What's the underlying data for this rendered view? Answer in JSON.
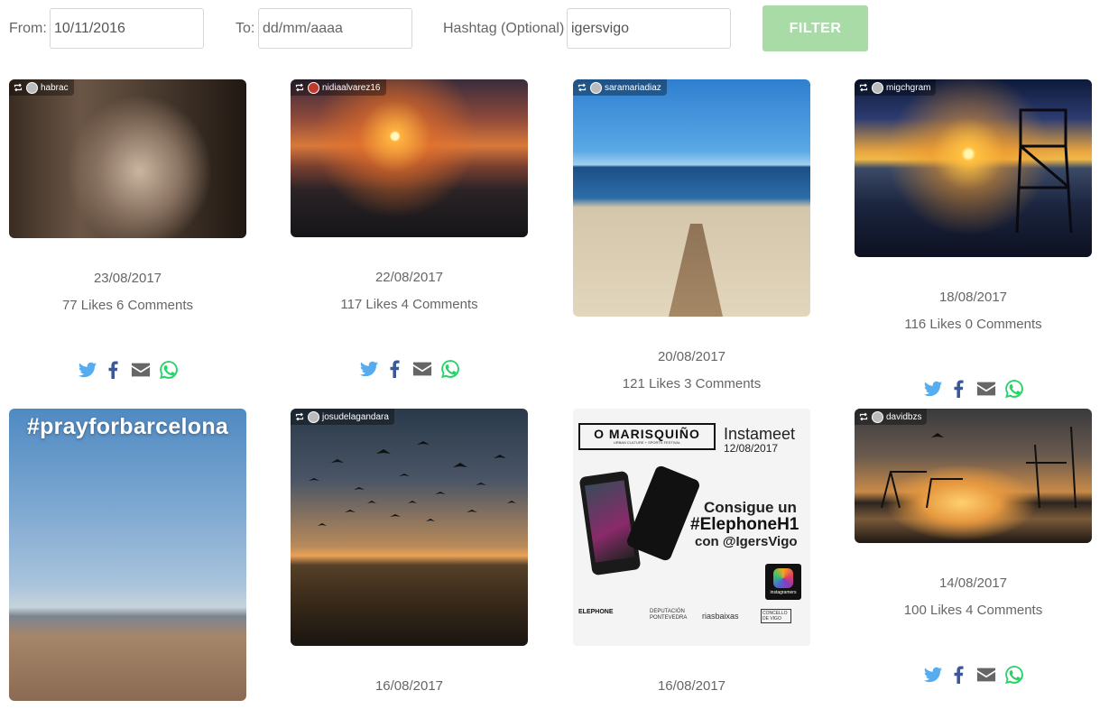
{
  "filters": {
    "from_label": "From:",
    "from_value": "10/11/2016",
    "to_label": "To:",
    "to_placeholder": "dd/mm/aaaa",
    "hashtag_label": "Hashtag (Optional)",
    "hashtag_value": "igersvigo",
    "filter_button": "FILTER"
  },
  "colors": {
    "twitter": "#55acee",
    "facebook": "#3b5998",
    "email": "#666666",
    "whatsapp": "#25d366",
    "filter_button": "#a9dba7"
  },
  "posts": [
    {
      "user": "habrac",
      "date": "23/08/2017",
      "stats": "77 Likes 6 Comments"
    },
    {
      "user": "nidiaalvarez16",
      "date": "22/08/2017",
      "stats": "117 Likes 4 Comments"
    },
    {
      "user": "saramariadiaz",
      "date": "20/08/2017",
      "stats": "121 Likes 3 Comments"
    },
    {
      "user": "migchgram",
      "date": "18/08/2017",
      "stats": "116 Likes 0 Comments"
    },
    {
      "user": "",
      "overlay_text": "#prayforbarcelona",
      "date": "",
      "stats": ""
    },
    {
      "user": "josudelagandara",
      "date": "16/08/2017",
      "stats": ""
    },
    {
      "user": "",
      "date": "16/08/2017",
      "stats": "",
      "poster": {
        "brand": "O MARISQUIÑO",
        "brand_sub": "URBAN CULTURE + SPORTS FESTIVAL",
        "event": "Instameet",
        "event_date": "12/08/2017",
        "line1": "Consigue un",
        "line2": "#ElephoneH1",
        "line3": "con @IgersVigo",
        "sponsors": [
          "ELEPHONE",
          "DEPUTACIÓN PONTEVEDRA",
          "riasbaixas",
          "CONCELLO DE VIGO"
        ],
        "badge": "instagramers"
      }
    },
    {
      "user": "davidbzs",
      "date": "14/08/2017",
      "stats": "100 Likes 4 Comments"
    }
  ]
}
